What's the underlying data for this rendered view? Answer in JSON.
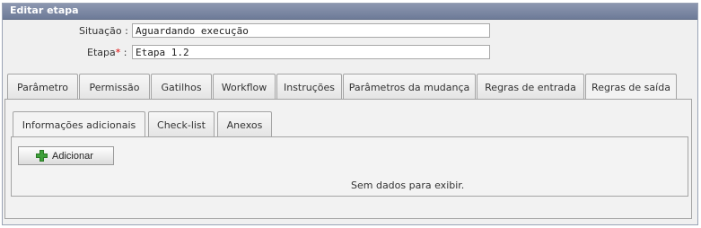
{
  "window": {
    "title": "Editar etapa"
  },
  "form": {
    "situacao_label": "Situação :",
    "situacao_value": "Aguardando execução",
    "etapa_label": "Etapa",
    "etapa_required": "*",
    "etapa_colon": " :",
    "etapa_value": "Etapa 1.2"
  },
  "tabs": [
    {
      "label": "Parâmetro"
    },
    {
      "label": "Permissão"
    },
    {
      "label": "Gatilhos"
    },
    {
      "label": "Workflow"
    },
    {
      "label": "Instruções"
    },
    {
      "label": "Parâmetros da mudança"
    },
    {
      "label": "Regras de entrada"
    },
    {
      "label": "Regras de saída",
      "active": true
    }
  ],
  "subtabs": [
    {
      "label": "Informações adicionais",
      "active": true
    },
    {
      "label": "Check-list"
    },
    {
      "label": "Anexos"
    }
  ],
  "actions": {
    "add_label": "Adicionar",
    "add_icon": "plus-icon"
  },
  "grid": {
    "empty_text": "Sem dados para exibir."
  },
  "colors": {
    "title_bar": "#7a86a3",
    "add_icon": "#3fa03a"
  }
}
